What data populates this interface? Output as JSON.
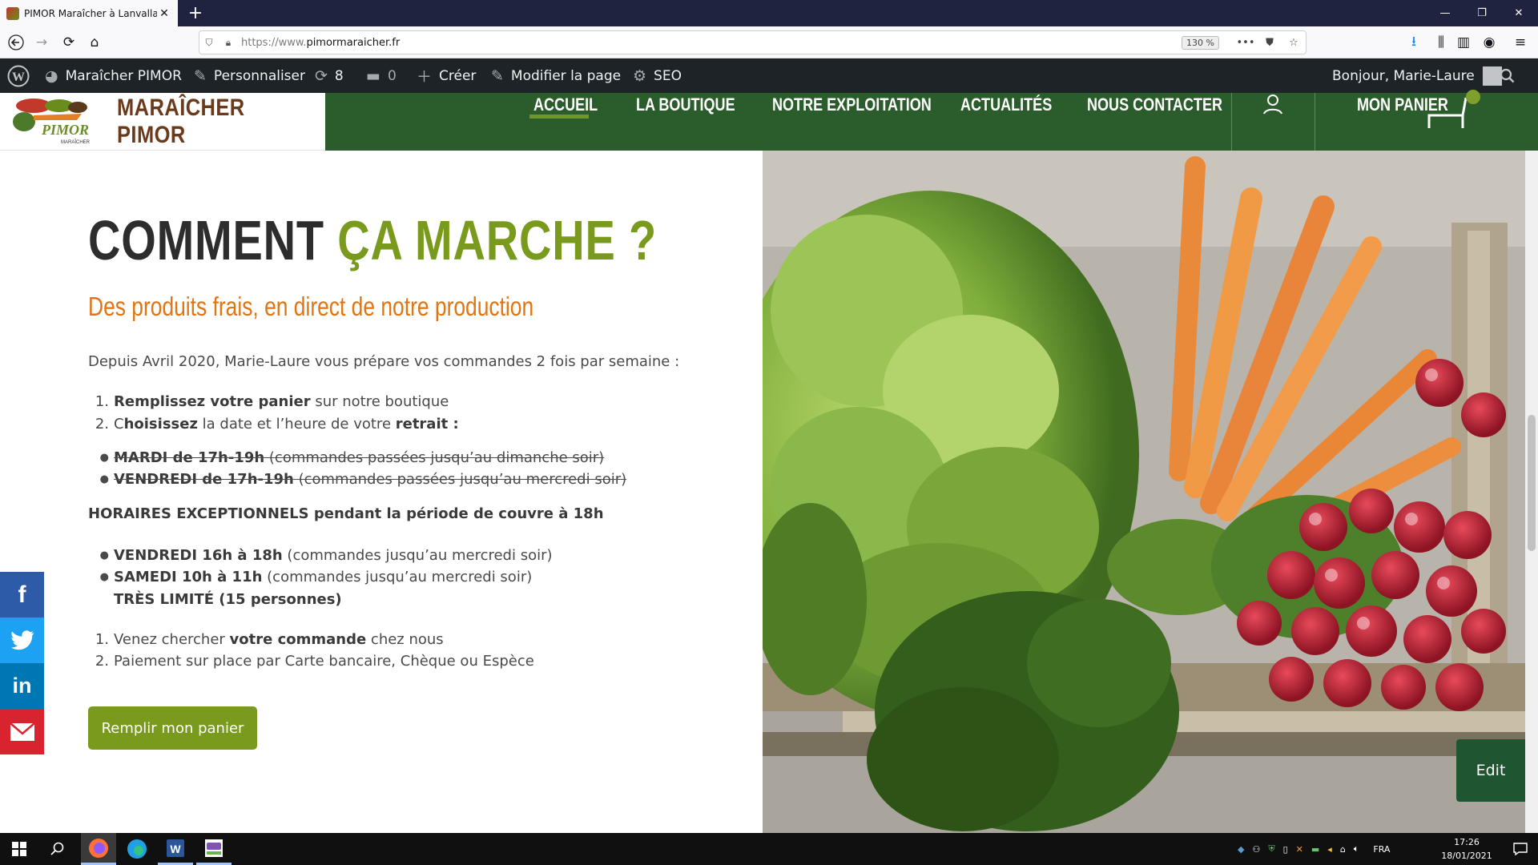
{
  "browser": {
    "tab_title": "PIMOR Maraîcher à Lanvallay, P",
    "url_protocol": "https://www.",
    "url_domain": "pimormaraicher.fr",
    "zoom": "130 %"
  },
  "wpbar": {
    "site": "Maraîcher PIMOR",
    "customize": "Personnaliser",
    "updates": "8",
    "comments": "0",
    "new": "Créer",
    "edit_page": "Modifier la page",
    "seo": "SEO",
    "greeting": "Bonjour, Marie-Laure"
  },
  "site": {
    "logo_text": "MARAÎCHER PIMOR",
    "logo_sub": "PIMOR",
    "logo_tag": "MARAÎCHER",
    "menu": [
      "ACCUEIL",
      "LA BOUTIQUE",
      "NOTRE EXPLOITATION",
      "ACTUALITÉS",
      "NOUS CONTACTER"
    ],
    "cart_label": "MON PANIER"
  },
  "content": {
    "title_a": "COMMENT ",
    "title_b": "ÇA MARCHE ?",
    "subtitle": "Des produits frais, en direct de notre production",
    "intro": "Depuis Avril 2020, Marie-Laure vous prépare vos commandes 2 fois par semaine :",
    "step1_bold": "Remplissez votre panier",
    "step1_rest": " sur notre boutique",
    "step2_c": "C",
    "step2_bold": "hoisissez",
    "step2_mid": " la date et l’heure de votre ",
    "step2_bold2": "retrait :",
    "old1_bold": "MARDI de 17h-19h",
    "old1_rest": " (commandes passées jusqu’au dimanche soir)",
    "old2_bold": "VENDREDI de 17h-19h",
    "old2_rest": " (commandes passées jusqu’au mercredi soir)",
    "exceptional": "HORAIRES EXCEPTIONNELS pendant la période de couvre à 18h",
    "new1_bold": "VENDREDI 16h à 18h",
    "new1_rest": " (commandes jusqu’au mercredi soir)",
    "new2_bold": "SAMEDI 10h à 11h",
    "new2_rest": " (commandes jusqu’au mercredi soir)",
    "limited": "TRÈS LIMITÉ (15 personnes)",
    "step3_pre": "Venez chercher ",
    "step3_bold": "votre commande",
    "step3_post": " chez nous",
    "step4": "Paiement sur place par Carte bancaire, Chèque ou Espèce",
    "cta": "Remplir mon panier",
    "edit": "Edit"
  },
  "share": [
    "facebook-icon",
    "twitter-icon",
    "linkedin-icon",
    "email-icon"
  ],
  "taskbar": {
    "lang": "FRA",
    "time": "17:26",
    "date": "18/01/2021"
  },
  "colors": {
    "green_dark": "#2b5c2c",
    "green_accent": "#7a9a1e",
    "orange": "#e07512",
    "wp_bar": "#1d2327",
    "facebook": "#2d5ba8",
    "twitter": "#1da1f2",
    "linkedin": "#0077b5",
    "email": "#d9232e"
  }
}
